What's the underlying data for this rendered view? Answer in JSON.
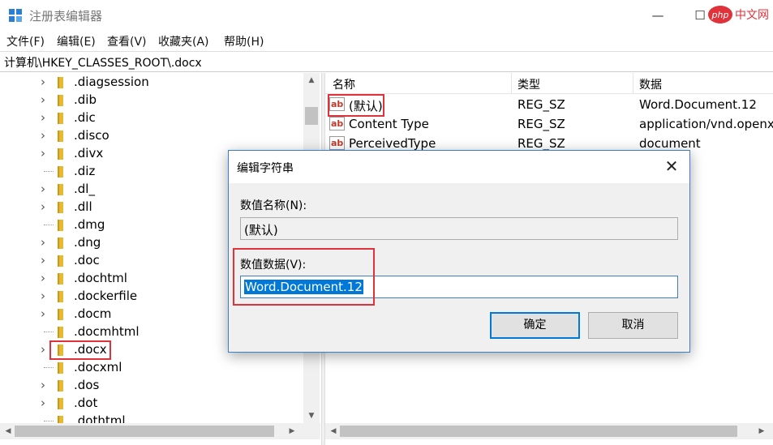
{
  "window": {
    "title": "注册表编辑器",
    "minimize": "—",
    "maximize": "☐",
    "watermark": "php中文网"
  },
  "menu": [
    "文件(F)",
    "编辑(E)",
    "查看(V)",
    "收藏夹(A)",
    "帮助(H)"
  ],
  "address": "计算机\\HKEY_CLASSES_ROOT\\.docx",
  "tree": {
    "items": [
      {
        "label": ".diagsession",
        "expandable": true
      },
      {
        "label": ".dib",
        "expandable": true
      },
      {
        "label": ".dic",
        "expandable": true
      },
      {
        "label": ".disco",
        "expandable": true
      },
      {
        "label": ".divx",
        "expandable": true
      },
      {
        "label": ".diz",
        "expandable": false
      },
      {
        "label": ".dl_",
        "expandable": true
      },
      {
        "label": ".dll",
        "expandable": true
      },
      {
        "label": ".dmg",
        "expandable": false
      },
      {
        "label": ".dng",
        "expandable": true
      },
      {
        "label": ".doc",
        "expandable": true
      },
      {
        "label": ".dochtml",
        "expandable": true
      },
      {
        "label": ".dockerfile",
        "expandable": true
      },
      {
        "label": ".docm",
        "expandable": true
      },
      {
        "label": ".docmhtml",
        "expandable": false
      },
      {
        "label": ".docx",
        "expandable": true
      },
      {
        "label": ".docxml",
        "expandable": false
      },
      {
        "label": ".dos",
        "expandable": true
      },
      {
        "label": ".dot",
        "expandable": true
      },
      {
        "label": ".dothtml",
        "expandable": false
      }
    ]
  },
  "list": {
    "headers": {
      "name": "名称",
      "type": "类型",
      "data": "数据"
    },
    "rows": [
      {
        "name": "(默认)",
        "type": "REG_SZ",
        "data": "Word.Document.12"
      },
      {
        "name": "Content Type",
        "type": "REG_SZ",
        "data": "application/vnd.openx"
      },
      {
        "name": "PerceivedType",
        "type": "REG_SZ",
        "data": "document"
      }
    ]
  },
  "dialog": {
    "title": "编辑字符串",
    "value_name_label": "数值名称(N):",
    "value_name": "(默认)",
    "value_data_label": "数值数据(V):",
    "value_data": "Word.Document.12",
    "ok_label": "确定",
    "cancel_label": "取消"
  },
  "colors": {
    "highlight": "#e0323a",
    "selection": "#0078d7",
    "folder": "#e8b830"
  }
}
